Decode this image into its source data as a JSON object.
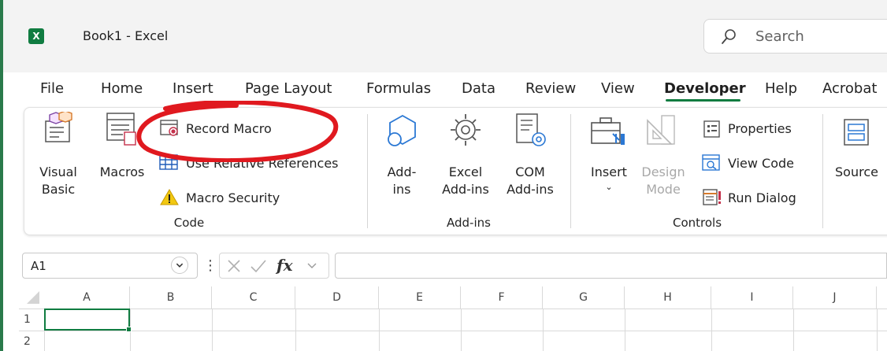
{
  "app": {
    "window_title": "Book1  -  Excel",
    "icon_letter": "X"
  },
  "search": {
    "label": "Search"
  },
  "tabs": [
    {
      "label": "File"
    },
    {
      "label": "Home"
    },
    {
      "label": "Insert"
    },
    {
      "label": "Page Layout"
    },
    {
      "label": "Formulas"
    },
    {
      "label": "Data"
    },
    {
      "label": "Review"
    },
    {
      "label": "View"
    },
    {
      "label": "Developer",
      "active": true
    },
    {
      "label": "Help"
    },
    {
      "label": "Acrobat"
    }
  ],
  "ribbon": {
    "code": {
      "group_label": "Code",
      "visual_basic": [
        "Visual",
        "Basic"
      ],
      "macros": "Macros",
      "record_macro": "Record Macro",
      "use_relative": "Use Relative References",
      "macro_security": "Macro Security"
    },
    "addins": {
      "group_label": "Add-ins",
      "addins": [
        "Add-",
        "ins"
      ],
      "excel_addins": [
        "Excel",
        "Add-ins"
      ],
      "com_addins": [
        "COM",
        "Add-ins"
      ]
    },
    "controls": {
      "group_label": "Controls",
      "insert": "Insert",
      "design_mode": [
        "Design",
        "Mode"
      ],
      "properties": "Properties",
      "view_code": "View Code",
      "run_dialog": "Run Dialog"
    },
    "xml": {
      "source": "Source"
    }
  },
  "formula_bar": {
    "name_box": "A1",
    "fx_symbol": "fx",
    "value": ""
  },
  "grid": {
    "columns": [
      "A",
      "B",
      "C",
      "D",
      "E",
      "F",
      "G",
      "H",
      "I",
      "J"
    ],
    "rows": [
      "1",
      "2"
    ],
    "active_cell": "A1"
  },
  "colors": {
    "accent": "#107c41",
    "annotation": "#e0191f"
  }
}
